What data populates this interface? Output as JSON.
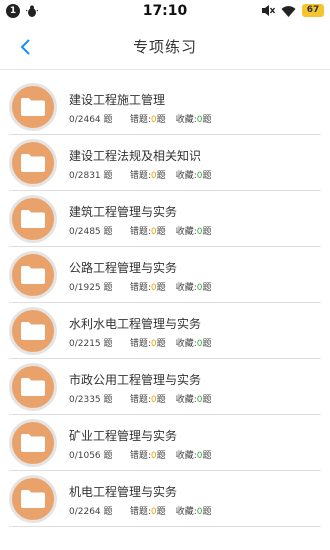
{
  "status_bar": {
    "notification_count": "1",
    "time": "17:10",
    "battery": "67"
  },
  "header": {
    "title": "专项练习"
  },
  "labels": {
    "unit": "题",
    "wrong": "错题:",
    "saved": "收藏:"
  },
  "colors": {
    "avatar": "#e9a36a",
    "accent": "#1a8cff",
    "wrong_count": "#f0a500",
    "saved_count": "#3da84a"
  },
  "items": [
    {
      "title": "建设工程施工管理",
      "progress": "0/2464",
      "wrong": "0",
      "saved": "0"
    },
    {
      "title": "建设工程法规及相关知识",
      "progress": "0/2831",
      "wrong": "0",
      "saved": "0"
    },
    {
      "title": "建筑工程管理与实务",
      "progress": "0/2485",
      "wrong": "0",
      "saved": "0"
    },
    {
      "title": "公路工程管理与实务",
      "progress": "0/1925",
      "wrong": "0",
      "saved": "0"
    },
    {
      "title": "水利水电工程管理与实务",
      "progress": "0/2215",
      "wrong": "0",
      "saved": "0"
    },
    {
      "title": "市政公用工程管理与实务",
      "progress": "0/2335",
      "wrong": "0",
      "saved": "0"
    },
    {
      "title": "矿业工程管理与实务",
      "progress": "0/1056",
      "wrong": "0",
      "saved": "0"
    },
    {
      "title": "机电工程管理与实务",
      "progress": "0/2264",
      "wrong": "0",
      "saved": "0"
    }
  ]
}
